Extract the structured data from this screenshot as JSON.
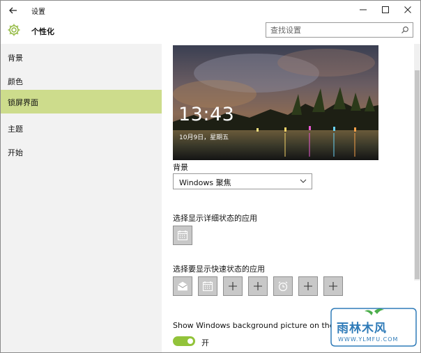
{
  "window": {
    "title": "设置"
  },
  "header": {
    "page_title": "个性化",
    "search_placeholder": "查找设置"
  },
  "sidebar": {
    "items": [
      {
        "label": "背景"
      },
      {
        "label": "颜色"
      },
      {
        "label": "锁屏界面"
      },
      {
        "label": "主题"
      },
      {
        "label": "开始"
      }
    ],
    "active_index": 2,
    "active_color": "#cddc8c"
  },
  "lockscreen": {
    "preview_time": "13:43",
    "preview_date": "10月9日，星期五",
    "background_label": "背景",
    "background_value": "Windows 聚焦",
    "detail_status_label": "选择显示详细状态的应用",
    "detail_status_apps": [
      "calendar-icon"
    ],
    "quick_status_label": "选择要显示快速状态的应用",
    "quick_status_apps": [
      "mail-icon",
      "calendar-icon",
      "plus-icon",
      "plus-icon",
      "alarm-icon",
      "plus-icon",
      "plus-icon"
    ],
    "show_bg_label": "Show Windows background picture on the",
    "toggle_state": "开",
    "toggle_on": true,
    "toggle_color": "#92c33a"
  },
  "watermark": {
    "text": "雨林木风",
    "url": "WWW.YLMFU.COM"
  }
}
